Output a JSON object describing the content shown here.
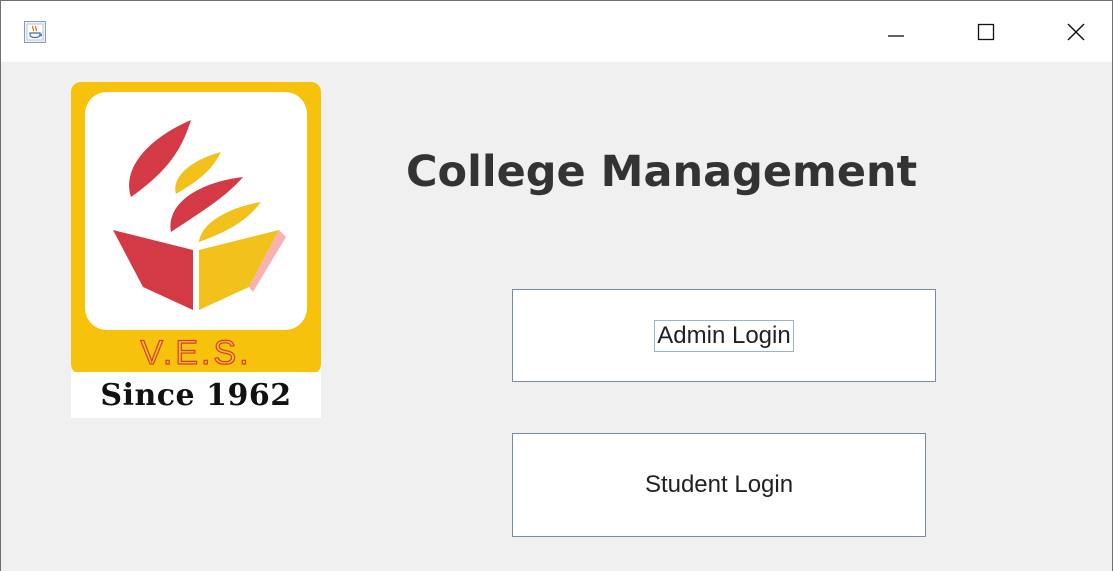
{
  "window": {
    "icons": {
      "app": "java-coffee-icon",
      "minimize": "minimize-icon",
      "maximize": "maximize-icon",
      "close": "close-icon"
    }
  },
  "logo": {
    "initials": "V.E.S.",
    "since": "Since 1962",
    "colors": {
      "frame": "#f7c20b",
      "red": "#d43a45",
      "yellow": "#f2c11b"
    }
  },
  "main": {
    "title": "College Management",
    "admin_login_label": "Admin Login",
    "student_login_label": "Student Login"
  }
}
